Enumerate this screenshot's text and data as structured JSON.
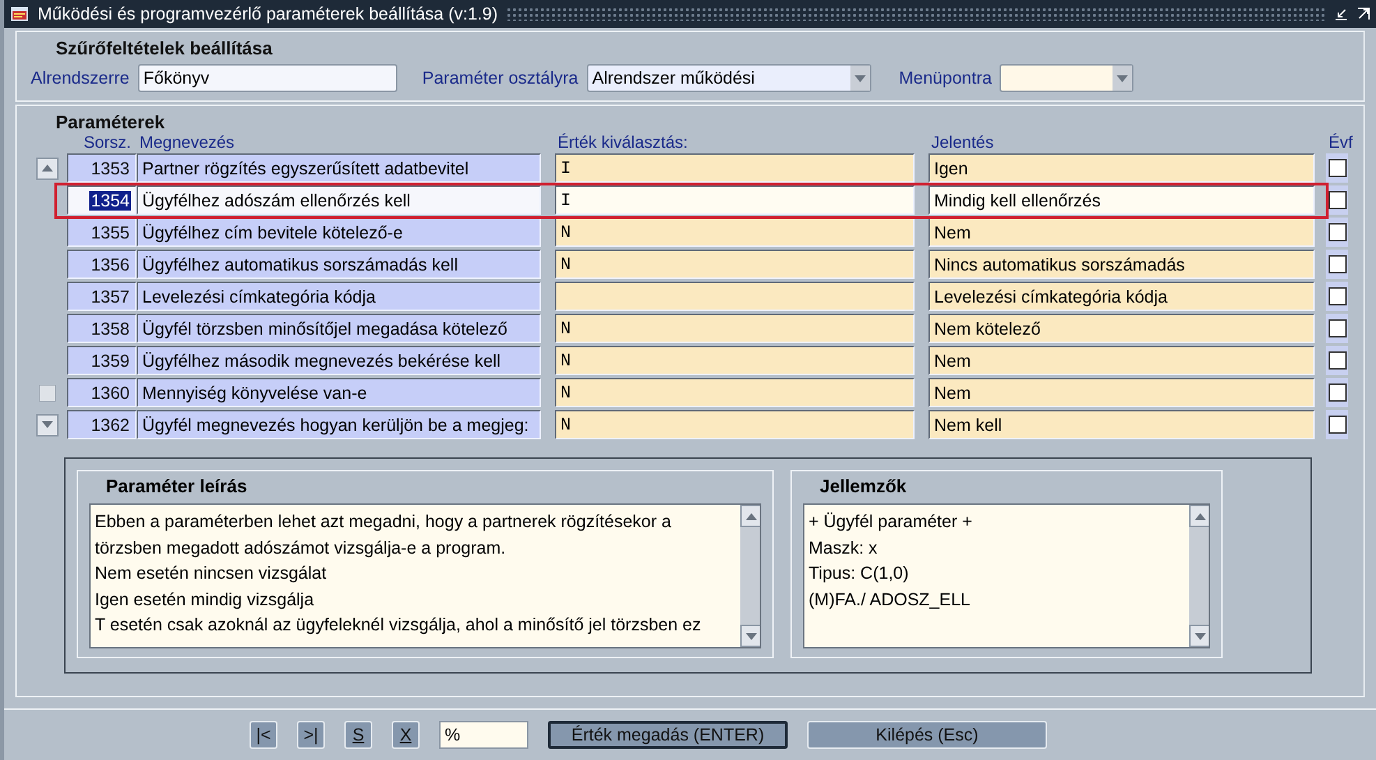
{
  "window": {
    "title": "Működési és programvezérlő paraméterek beállítása (v:1.9)"
  },
  "filter": {
    "title": "Szűrőfeltételek beállítása",
    "fields": [
      {
        "kind": "text",
        "label": "Alrendszerre",
        "value": "Főkönyv"
      },
      {
        "kind": "select",
        "label": "Paraméter osztályra",
        "value": "Alrendszer működési"
      },
      {
        "kind": "select",
        "label": "Menüpontra"
      }
    ]
  },
  "parameters": {
    "title": "Paraméterek",
    "columns": [
      "Sorsz.",
      "Megnevezés",
      "Érték kiválasztás:",
      "Jelentés",
      "Évf"
    ],
    "rows": [
      {
        "number": "1353",
        "name": "Partner rögzítés egyszerűsített adatbevitel",
        "value": "I",
        "meaning": "Igen",
        "checked": false,
        "selected": false
      },
      {
        "number": "1354",
        "name": "Ügyfélhez adószám ellenőrzés kell",
        "value": "I",
        "meaning": "Mindig kell ellenőrzés",
        "checked": false,
        "selected": true
      },
      {
        "number": "1355",
        "name": "Ügyfélhez cím bevitele kötelező-e",
        "value": "N",
        "meaning": "Nem",
        "checked": false,
        "selected": false
      },
      {
        "number": "1356",
        "name": "Ügyfélhez automatikus sorszámadás kell",
        "value": "N",
        "meaning": "Nincs automatikus sorszámadás",
        "checked": false,
        "selected": false
      },
      {
        "number": "1357",
        "name": "Levelezési címkategória kódja",
        "value": "",
        "meaning": "Levelezési címkategória kódja",
        "checked": false,
        "selected": false
      },
      {
        "number": "1358",
        "name": "Ügyfél törzsben minősítőjel megadása kötelező",
        "value": "N",
        "meaning": "Nem kötelező",
        "checked": false,
        "selected": false
      },
      {
        "number": "1359",
        "name": "Ügyfélhez második megnevezés bekérése kell",
        "value": "N",
        "meaning": "Nem",
        "checked": false,
        "selected": false
      },
      {
        "number": "1360",
        "name": "Mennyiség könyvelése van-e",
        "value": "N",
        "meaning": "Nem",
        "checked": false,
        "selected": false
      },
      {
        "number": "1362",
        "name": "Ügyfél megnevezés hogyan kerüljön be a megjeg:",
        "value": "N",
        "meaning": "Nem kell",
        "checked": false,
        "selected": false
      }
    ]
  },
  "description": {
    "title": "Paraméter leírás",
    "lines": [
      "Ebben a paraméterben lehet azt megadni, hogy a partnerek rögzítésekor a",
      "törzsben megadott adószámot vizsgálja-e a program.",
      "Nem esetén nincsen vizsgálat",
      "Igen esetén mindig vizsgálja",
      "T esetén csak azoknál az ügyfeleknél vizsgálja, ahol a minősítő jel törzsben ez"
    ]
  },
  "properties": {
    "title": "Jellemzők",
    "lines": [
      "+ Ügyfél paraméter +",
      "Maszk: x",
      "Tipus: C(1,0)",
      "(M)FA./ ADOSZ_ELL"
    ]
  },
  "toolbar": [
    {
      "kind": "small",
      "label": "|<",
      "default": false
    },
    {
      "kind": "small",
      "label": ">|",
      "default": false
    },
    {
      "kind": "small",
      "label": "S",
      "default": false
    },
    {
      "kind": "small",
      "label": "X",
      "default": false
    },
    {
      "kind": "field",
      "value": "%"
    },
    {
      "kind": "wide",
      "label": "Érték megadás (ENTER)",
      "default": true
    },
    {
      "kind": "wide",
      "label": "Kilépés (Esc)",
      "default": false
    }
  ]
}
